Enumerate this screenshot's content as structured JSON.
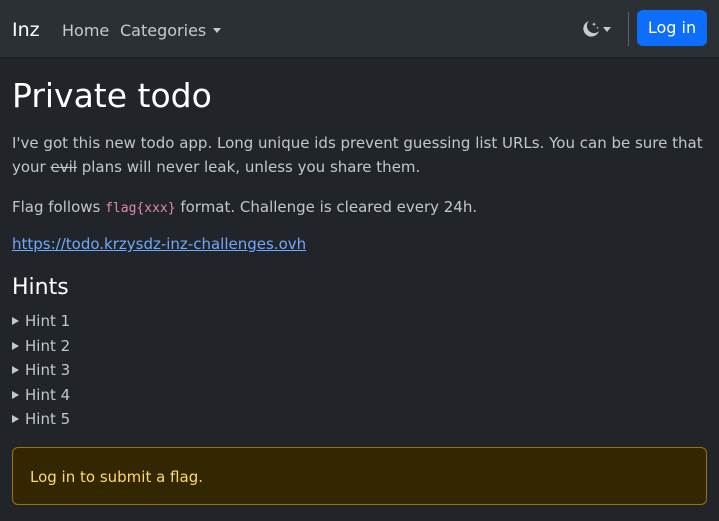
{
  "navbar": {
    "brand": "Inz",
    "home": "Home",
    "categories": "Categories",
    "theme_icon": "moon-stars-icon",
    "login": "Log in"
  },
  "main": {
    "title": "Private todo",
    "intro_before": "I've got this new todo app. Long unique ids prevent guessing list URLs. You can be sure that your ",
    "intro_struck": "evil",
    "intro_after": " plans will never leak, unless you share them.",
    "flag_before": "Flag follows ",
    "flag_code": "flag{xxx}",
    "flag_after": " format. Challenge is cleared every 24h.",
    "link": "https://todo.krzysdz-inz-challenges.ovh"
  },
  "hints": {
    "title": "Hints",
    "items": [
      "Hint 1",
      "Hint 2",
      "Hint 3",
      "Hint 4",
      "Hint 5"
    ]
  },
  "alert": {
    "text": "Log in to submit a flag."
  },
  "colors": {
    "background": "#212529",
    "navbar": "#2b3035",
    "primary": "#0d6efd",
    "link": "#6ea8fe",
    "code": "#e685b5",
    "alert_bg": "#332701",
    "alert_border": "#997404",
    "alert_text": "#ffda6a"
  }
}
